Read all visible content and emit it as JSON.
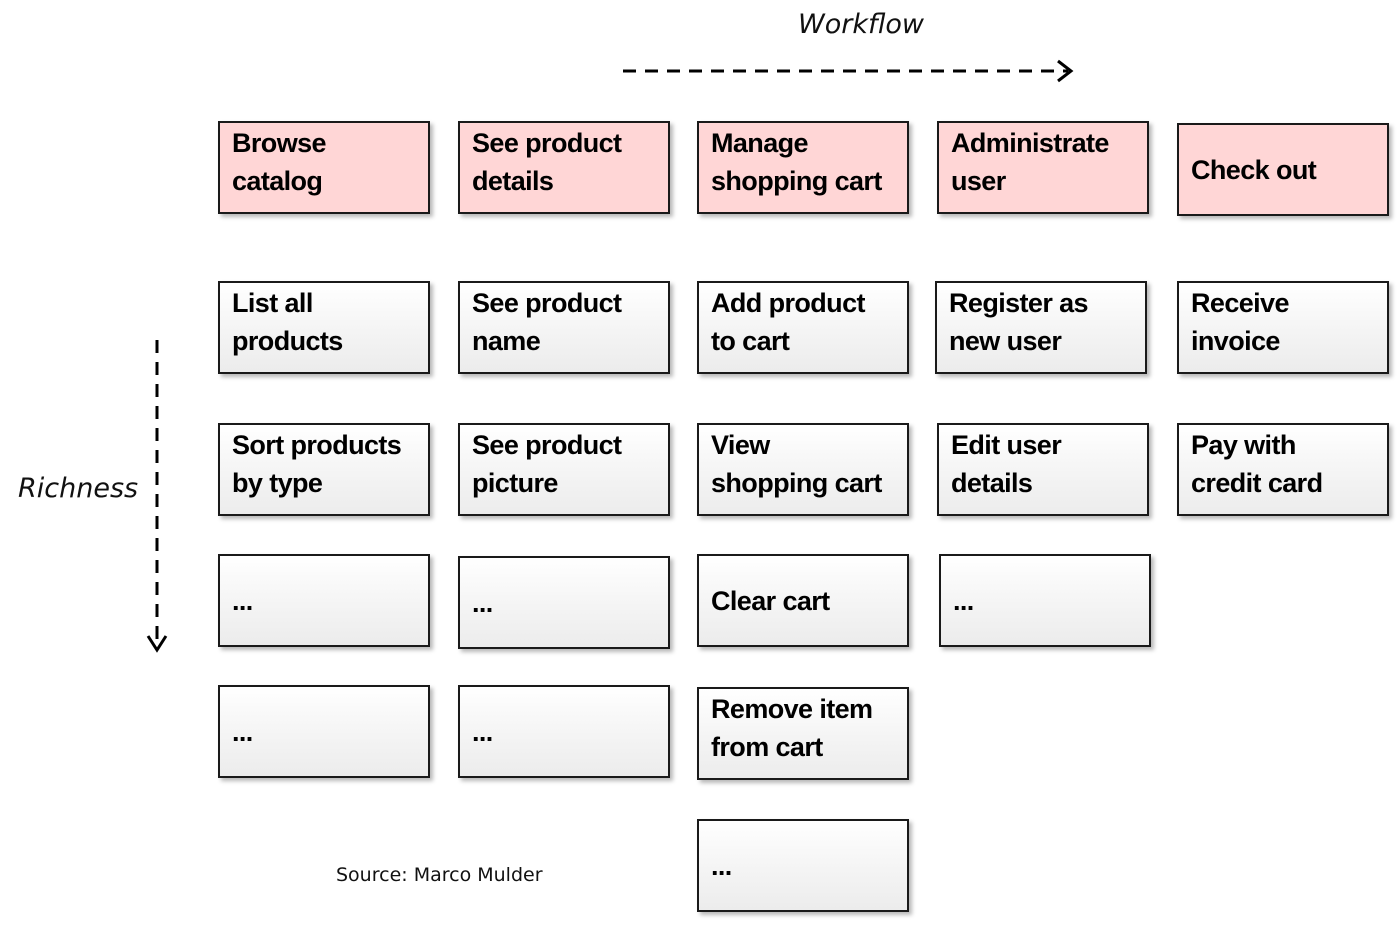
{
  "axes": {
    "workflow": "Workflow",
    "richness": "Richness"
  },
  "columns": [
    {
      "activity": "Browse\ncatalog",
      "stories": [
        "List all\nproducts",
        "Sort products\nby type",
        "...",
        "..."
      ]
    },
    {
      "activity": "See product\ndetails",
      "stories": [
        "See product\nname",
        "See product\npicture",
        "...",
        "..."
      ]
    },
    {
      "activity": "Manage\nshopping cart",
      "stories": [
        "Add product\nto cart",
        "View\nshopping cart",
        "Clear cart",
        "Remove item\nfrom cart",
        "..."
      ]
    },
    {
      "activity": "Administrate\nuser",
      "stories": [
        "Register as\nnew user",
        "Edit user\ndetails",
        "..."
      ]
    },
    {
      "activity": "Check out",
      "stories": [
        "Receive\ninvoice",
        "Pay with\ncredit card"
      ]
    }
  ],
  "source": "Source:  Marco Mulder"
}
